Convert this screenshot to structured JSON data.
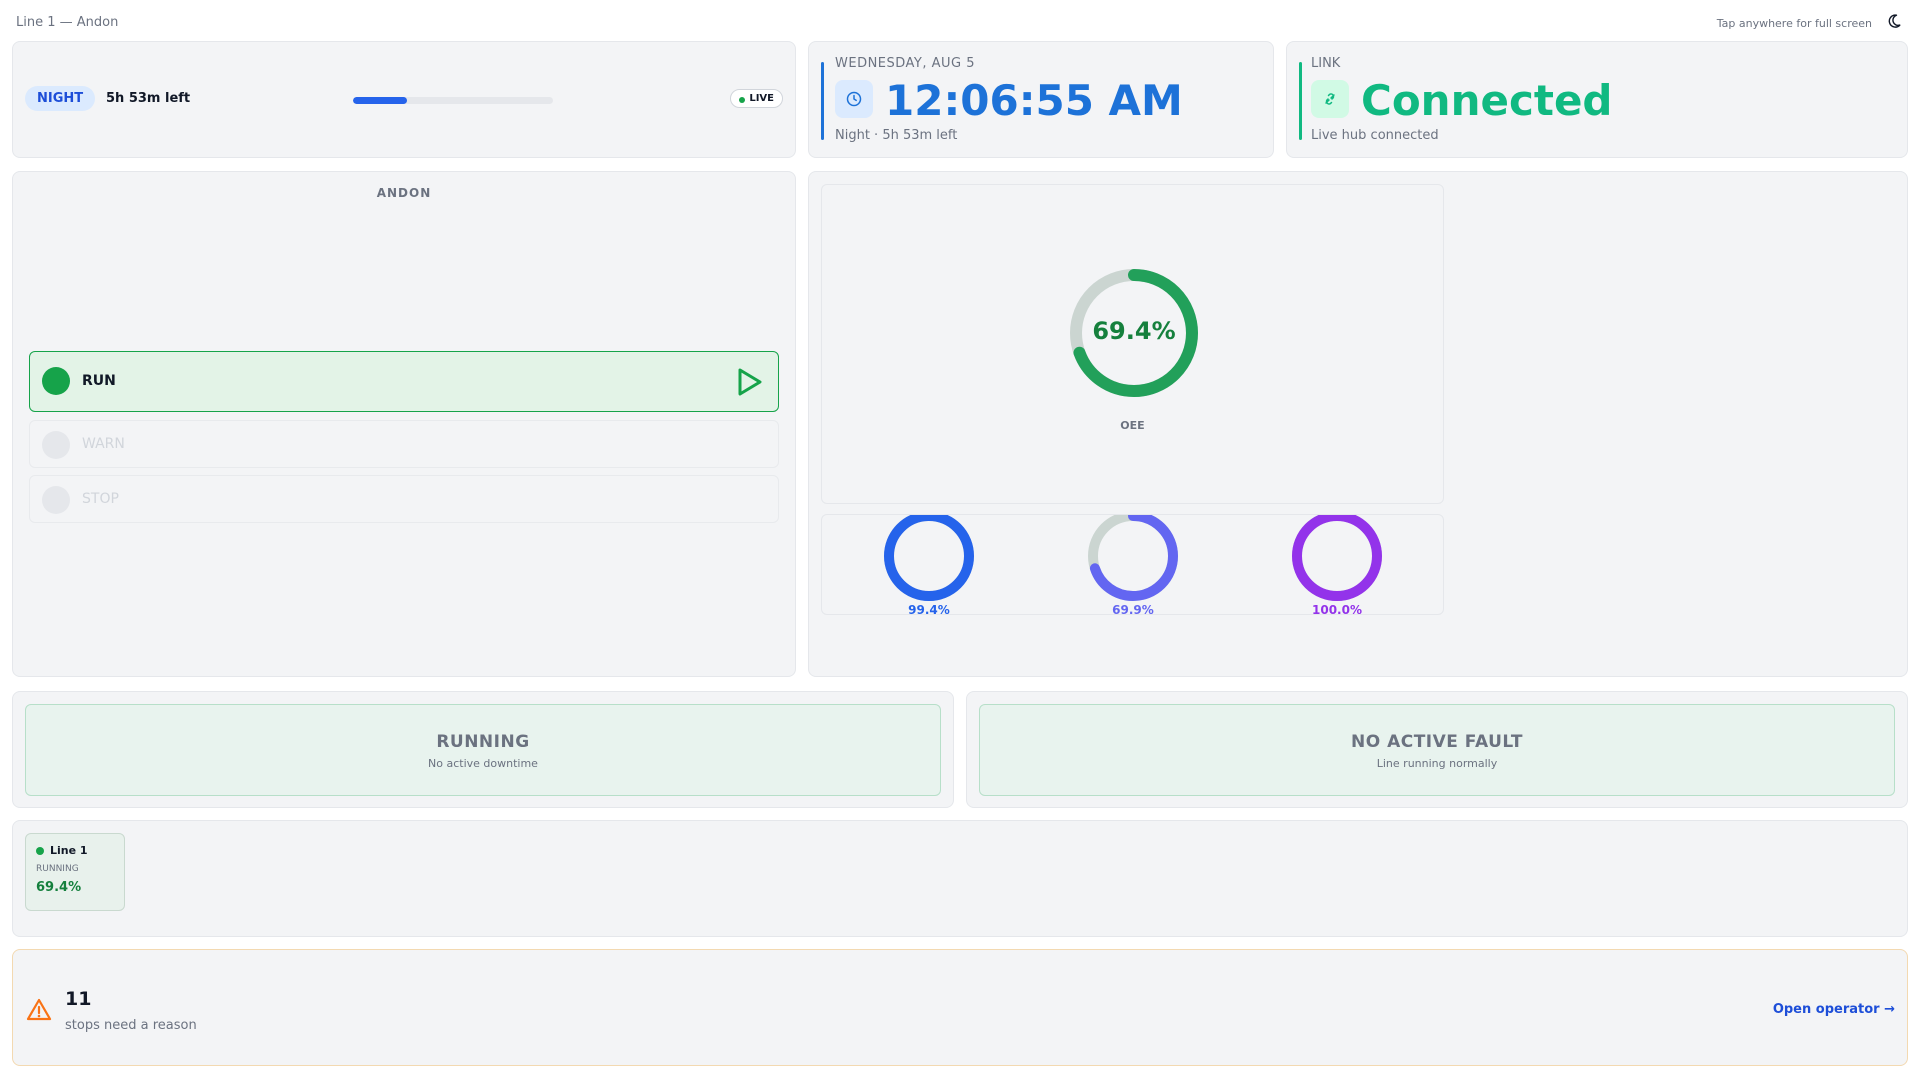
{
  "header": {
    "title": "Line 1 — Andon",
    "hint": "Tap anywhere for full screen",
    "theme_icon": "moon-icon"
  },
  "shift": {
    "name": "NIGHT",
    "remaining": "5h 53m left",
    "progress_percent": 27,
    "live_label": "LIVE"
  },
  "clock": {
    "date": "WEDNESDAY, AUG 5",
    "time": "12:06:55 AM",
    "subtitle": "Night · 5h 53m left",
    "accent": "#1d72d8",
    "icon": "clock-icon"
  },
  "link": {
    "title": "LINK",
    "status": "Connected",
    "subtitle": "Live hub connected",
    "accent": "#10b981",
    "icon": "link-icon"
  },
  "andon": {
    "title": "ANDON",
    "states": [
      {
        "label": "RUN",
        "active": true,
        "color": "#16a34a"
      },
      {
        "label": "WARN",
        "active": false,
        "color": "#e5e7eb"
      },
      {
        "label": "STOP",
        "active": false,
        "color": "#e5e7eb"
      }
    ]
  },
  "oee": {
    "value_percent": 69.4,
    "value_label": "69.4%",
    "label": "OEE",
    "color": "#22a05a",
    "components": [
      {
        "value_percent": 99.4,
        "value_label": "99.4%",
        "color": "#2563eb"
      },
      {
        "value_percent": 69.9,
        "value_label": "69.9%",
        "color": "#6366f1"
      },
      {
        "value_percent": 100.0,
        "value_label": "100.0%",
        "color": "#9333ea"
      }
    ]
  },
  "status": {
    "downtime": {
      "title": "RUNNING",
      "subtitle": "No active downtime"
    },
    "fault": {
      "title": "NO ACTIVE FAULT",
      "subtitle": "Line running normally"
    }
  },
  "lines": [
    {
      "name": "Line 1",
      "state": "RUNNING",
      "oee": "69.4%"
    }
  ],
  "alert": {
    "count": "11",
    "message": "stops need a reason",
    "link": "Open operator →",
    "icon": "warning-icon"
  }
}
